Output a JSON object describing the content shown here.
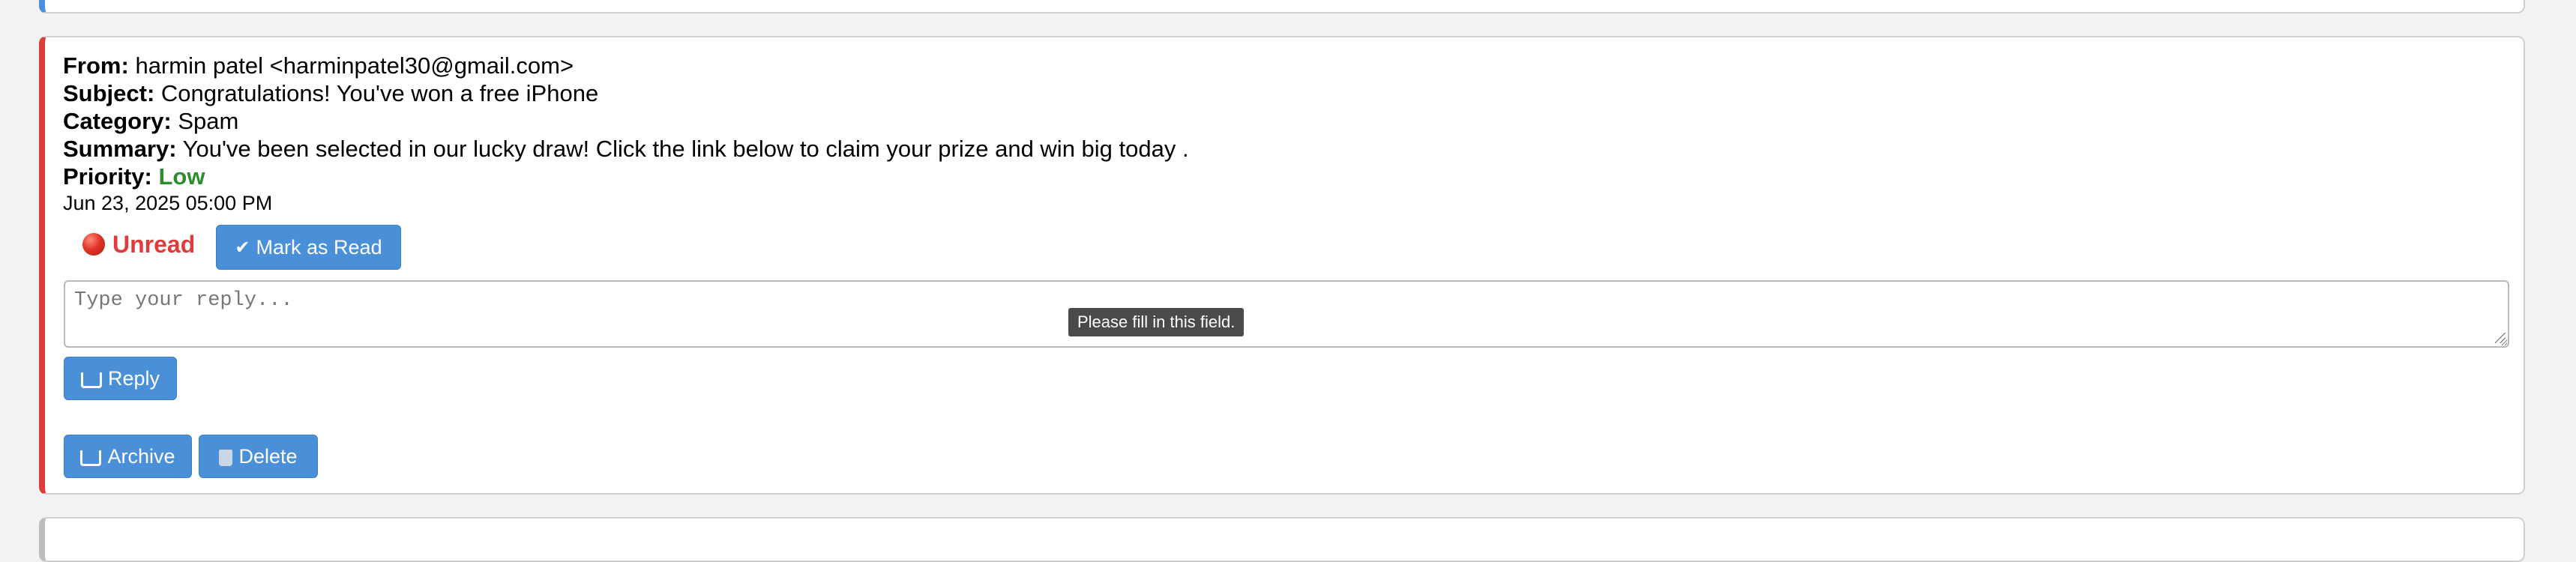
{
  "email": {
    "from_label": "From:",
    "from_value": "harmin patel <harminpatel30@gmail.com>",
    "subject_label": "Subject:",
    "subject_value": "Congratulations! You've won a free iPhone",
    "category_label": "Category:",
    "category_value": "Spam",
    "summary_label": "Summary:",
    "summary_value": "You've been selected in our lucky draw! Click the link below to claim your prize and win big today .",
    "priority_label": "Priority:",
    "priority_value": "Low",
    "date": "Jun 23, 2025 05:00 PM"
  },
  "status": {
    "label": "Unread",
    "icon": "red-circle-icon"
  },
  "actions": {
    "mark_read": "Mark as Read",
    "mark_read_icon": "✔",
    "reply": "Reply",
    "archive": "Archive",
    "delete": "Delete"
  },
  "reply_box": {
    "placeholder": "Type your reply...",
    "value": ""
  },
  "tooltip": {
    "text": "Please fill in this field."
  },
  "colors": {
    "accent": "#4a90d9",
    "unread_border": "#e03b3b",
    "priority_low": "#2e8b2e"
  }
}
